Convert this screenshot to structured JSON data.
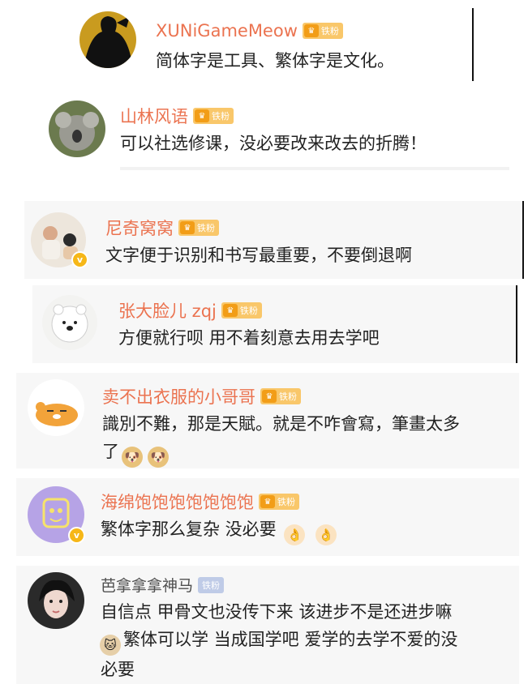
{
  "comments": [
    {
      "user": "XUNiGameMeow",
      "badge": "铁粉",
      "text": "简体字是工具、繁体字是文化。"
    },
    {
      "user": "山林风语",
      "badge": "铁粉",
      "text": "可以社选修课，没必要改来改去的折腾！"
    },
    {
      "user": "尼奇窝窝",
      "badge": "铁粉",
      "text": "文字便于识别和书写最重要，不要倒退啊"
    },
    {
      "user": "张大脸儿 zqj",
      "badge": "铁粉",
      "text": "方便就行呗  用不着刻意去用去学吧"
    },
    {
      "user": "卖不出衣服的小哥哥",
      "badge": "铁粉",
      "text_line1": "識別不難，那是天賦。就是不咋會寫，筆畫太多",
      "text_line2": "了"
    },
    {
      "user": "海绵饱饱饱饱饱饱饱",
      "badge": "铁粉",
      "text": "繁体字那么复杂 没必要"
    },
    {
      "user": "芭拿拿拿神马",
      "badge": "铁粉",
      "text_line1": "自信点  甲骨文也没传下来  该进步不是还进步嘛",
      "text_line2": "繁体可以学  当成国学吧  爱学的去学不爱的没",
      "text_line3": "必要"
    }
  ],
  "icons": {
    "verified": "v-badge-icon",
    "crown": "crown-icon",
    "doge": "doge-emoji-icon",
    "ok_hand": "ok-hand-emoji-icon",
    "cat": "cat-emoji-icon"
  },
  "colors": {
    "username": "#eb7350",
    "username_gray": "#4f4f4f",
    "badge": "#f9c76a",
    "text": "#222222"
  }
}
